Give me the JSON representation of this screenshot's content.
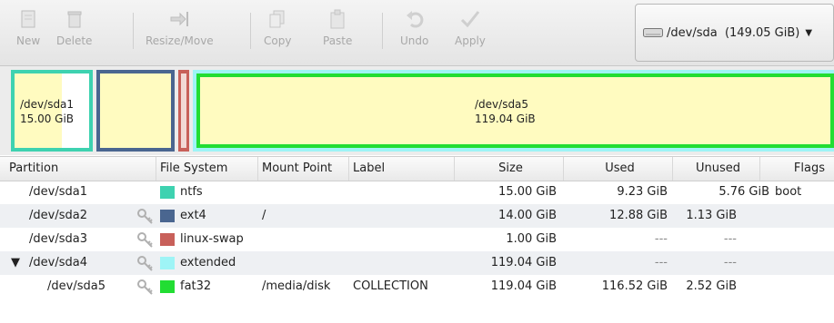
{
  "toolbar": {
    "new": "New",
    "delete": "Delete",
    "resize_move": "Resize/Move",
    "copy": "Copy",
    "paste": "Paste",
    "undo": "Undo",
    "apply": "Apply"
  },
  "device": {
    "label": "/dev/sda  (149.05 GiB)"
  },
  "graph": {
    "sda1": {
      "name": "/dev/sda1",
      "size": "15.00 GiB"
    },
    "sda5": {
      "name": "/dev/sda5",
      "size": "119.04 GiB"
    }
  },
  "table": {
    "headers": {
      "partition": "Partition",
      "file_system": "File System",
      "mount_point": "Mount Point",
      "label": "Label",
      "size": "Size",
      "used": "Used",
      "unused": "Unused",
      "flags": "Flags"
    },
    "rows": [
      {
        "partition": "/dev/sda1",
        "fs": "ntfs",
        "fs_color": "#3ed2b0",
        "mount": "",
        "label": "",
        "size": "15.00 GiB",
        "used": "9.23 GiB",
        "unused": "5.76 GiB",
        "flags": "boot"
      },
      {
        "partition": "/dev/sda2",
        "fs": "ext4",
        "fs_color": "#4a6690",
        "mount": "/",
        "label": "",
        "size": "14.00 GiB",
        "used": "12.88 GiB",
        "unused": "1.13 GiB",
        "flags": ""
      },
      {
        "partition": "/dev/sda3",
        "fs": "linux-swap",
        "fs_color": "#c8605a",
        "mount": "",
        "label": "",
        "size": "1.00 GiB",
        "used": "---",
        "unused": "---",
        "flags": ""
      },
      {
        "partition": "/dev/sda4",
        "expander": "▼",
        "fs": "extended",
        "fs_color": "#9ef4f6",
        "mount": "",
        "label": "",
        "size": "119.04 GiB",
        "used": "---",
        "unused": "---",
        "flags": ""
      },
      {
        "partition": "/dev/sda5",
        "fs": "fat32",
        "fs_color": "#22dd33",
        "mount": "/media/disk",
        "label": "COLLECTION",
        "size": "119.04 GiB",
        "used": "116.52 GiB",
        "unused": "2.52 GiB",
        "flags": ""
      }
    ]
  },
  "colors": {
    "ntfs": "#3ed2b0",
    "ext4": "#4a6690",
    "swap": "#c8605a",
    "fat32": "#22dd33",
    "partition_fill": "#fffbc0"
  }
}
